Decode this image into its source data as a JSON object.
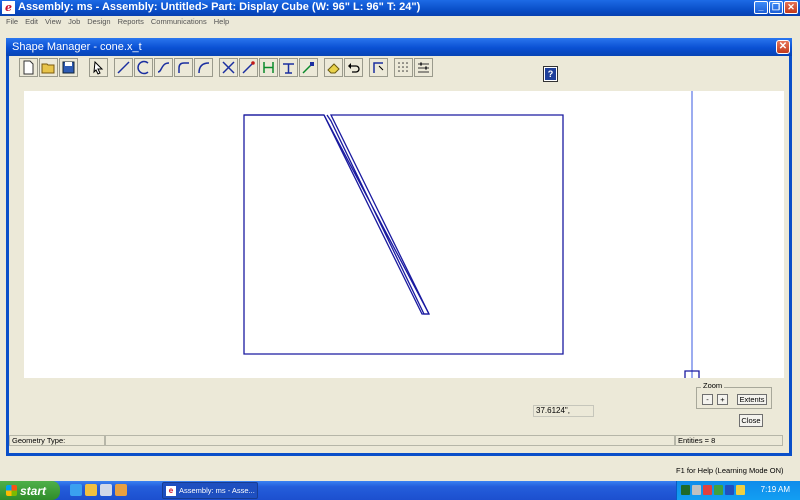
{
  "app": {
    "title": "Assembly: ms - Assembly: Untitled> Part: Display Cube (W: 96\" L: 96\" T: 24\")",
    "logo": "e",
    "menu": [
      "File",
      "Edit",
      "View",
      "Job",
      "Design",
      "Reports",
      "Communications",
      "Help"
    ],
    "status_hint": "F1 for Help (Learning Mode ON)"
  },
  "dialog": {
    "title": "Shape Manager - cone.x_t",
    "close_glyph": "✕",
    "help_glyph": "?",
    "toolbar_icons": [
      "new-file-icon",
      "open-folder-icon",
      "save-icon",
      "select-arrow-icon",
      "line-icon",
      "arc-icon",
      "curve-icon",
      "fillet-icon",
      "corner-icon",
      "trim-icon",
      "extend-line-icon",
      "align-icon",
      "split-icon",
      "move-icon",
      "eraser-icon",
      "undo-icon",
      "edit-shape-icon",
      "grid-icon",
      "settings-icon"
    ],
    "zoom": {
      "label": "Zoom",
      "minus": "-",
      "plus": "+",
      "extents": "Extents"
    },
    "close_label": "Close",
    "coordinate_readout": "37.6124\",",
    "status": {
      "geometry_type": "Geometry Type:",
      "entities": "Entities = 8"
    }
  },
  "taskbar": {
    "start_label": "start",
    "task_label": "Assembly: ms - Asse...",
    "clock": "7:19 AM"
  },
  "colors": {
    "shape_stroke": "#0000a8",
    "title_blue": "#0a50d3",
    "canvas_bg": "#ffffff"
  }
}
